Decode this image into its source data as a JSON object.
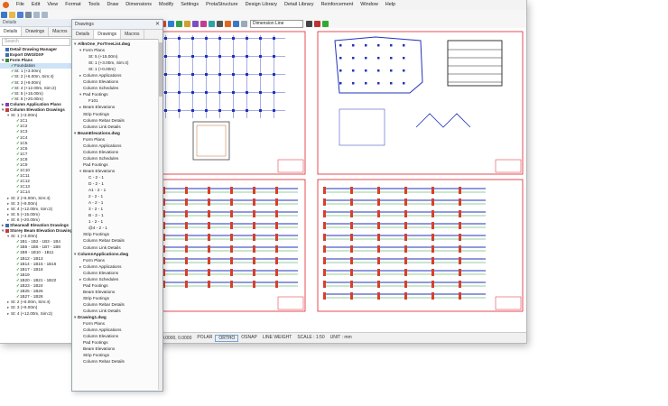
{
  "menu": [
    "File",
    "Edit",
    "View",
    "Format",
    "Tools",
    "Draw",
    "Dimensions",
    "Modify",
    "Settings",
    "ProtaStructure",
    "Design Library",
    "Detail Library",
    "Reinforcement",
    "Window",
    "Help"
  ],
  "toolbar": {
    "dimension_style": "Dimension Line"
  },
  "left_panel": {
    "title": "Details",
    "tabs": [
      "Details",
      "Drawings",
      "Macros"
    ],
    "search_placeholder": "Search",
    "tree": [
      {
        "label": "Detail Drawing Manager",
        "level": 0,
        "bold": true,
        "icon": "#3a6fb5"
      },
      {
        "label": "Export DWG/DXF",
        "level": 0,
        "bold": true,
        "icon": "#3a6fb5"
      },
      {
        "label": "Form Plans",
        "level": 0,
        "bold": true,
        "icon": "#3a8a3a",
        "tw": "▾"
      },
      {
        "label": "Foundation",
        "level": 1,
        "sel": true,
        "check": true
      },
      {
        "label": "St: 1 (+3.00m)",
        "level": 1,
        "check": true
      },
      {
        "label": "St: 2 (+6.00m, Sim:4)",
        "level": 1,
        "check": true
      },
      {
        "label": "St: 3 (+9.00m)",
        "level": 1,
        "check": true
      },
      {
        "label": "St: 4 (+12.00m, Sim:2)",
        "level": 1,
        "check": true
      },
      {
        "label": "St: 5 (+15.00m)",
        "level": 1,
        "check": true
      },
      {
        "label": "St: 6 (+20.00m)",
        "level": 1,
        "check": true
      },
      {
        "label": "Column Application Plans",
        "level": 0,
        "bold": true,
        "icon": "#8a3ab5",
        "tw": "▸"
      },
      {
        "label": "Column Elevation Drawings",
        "level": 0,
        "bold": true,
        "icon": "#c83a3a",
        "tw": "▾"
      },
      {
        "label": "St: 1 (+3.00m)",
        "level": 1,
        "tw": "▾"
      },
      {
        "label": "1C1",
        "level": 2,
        "check": true
      },
      {
        "label": "1C2",
        "level": 2,
        "check": true
      },
      {
        "label": "1C3",
        "level": 2,
        "check": true
      },
      {
        "label": "1C4",
        "level": 2,
        "check": true
      },
      {
        "label": "1C5",
        "level": 2,
        "check": true
      },
      {
        "label": "1C6",
        "level": 2,
        "check": true
      },
      {
        "label": "1C7",
        "level": 2,
        "check": true
      },
      {
        "label": "1C8",
        "level": 2,
        "check": true
      },
      {
        "label": "1C9",
        "level": 2,
        "check": true
      },
      {
        "label": "1C10",
        "level": 2,
        "check": true
      },
      {
        "label": "1C11",
        "level": 2,
        "check": true
      },
      {
        "label": "1C12",
        "level": 2,
        "check": true
      },
      {
        "label": "1C13",
        "level": 2,
        "check": true
      },
      {
        "label": "1C14",
        "level": 2,
        "check": true
      },
      {
        "label": "St: 2 (+6.00m, Sim:4)",
        "level": 1,
        "tw": "▸"
      },
      {
        "label": "St: 3 (+9.00m)",
        "level": 1,
        "tw": "▸"
      },
      {
        "label": "St: 4 (+12.00m, Sim:2)",
        "level": 1,
        "tw": "▸"
      },
      {
        "label": "St: 5 (+15.00m)",
        "level": 1,
        "tw": "▸"
      },
      {
        "label": "St: 6 (+20.00m)",
        "level": 1,
        "tw": "▸"
      },
      {
        "label": "Shearwall Elevation Drawings",
        "level": 0,
        "bold": true,
        "icon": "#3a6fb5",
        "tw": "▸"
      },
      {
        "label": "Storey Beam Elevation Drawings",
        "level": 0,
        "bold": true,
        "icon": "#c83a3a",
        "tw": "▾"
      },
      {
        "label": "St: 1 (+3.00m)",
        "level": 1,
        "tw": "▾"
      },
      {
        "label": "1B1 - 1B2 - 1B3 - 1B4",
        "level": 2,
        "check": true
      },
      {
        "label": "1B5 - 1B6 - 1B7 - 1B8",
        "level": 2,
        "check": true
      },
      {
        "label": "1B9 - 1B10 - 1B11",
        "level": 2,
        "check": true
      },
      {
        "label": "1B12 - 1B13",
        "level": 2,
        "check": true
      },
      {
        "label": "1B14 - 1B15 - 1B16",
        "level": 2,
        "check": true
      },
      {
        "label": "1B17 - 1B18",
        "level": 2,
        "check": true
      },
      {
        "label": "1B19",
        "level": 2,
        "check": true
      },
      {
        "label": "1B20 - 1B21 - 1B22",
        "level": 2,
        "check": true
      },
      {
        "label": "1B23 - 1B24",
        "level": 2,
        "check": true
      },
      {
        "label": "1B25 - 1B26",
        "level": 2,
        "check": true
      },
      {
        "label": "1B27 - 1B28",
        "level": 2,
        "check": true
      },
      {
        "label": "St: 2 (+6.00m, Sim:4)",
        "level": 1,
        "tw": "▸"
      },
      {
        "label": "St: 3 (+9.00m)",
        "level": 1,
        "tw": "▸"
      },
      {
        "label": "St: 4 (+12.00m, Sim:2)",
        "level": 1,
        "tw": "▸"
      }
    ]
  },
  "floating_panel": {
    "title": "Drawings",
    "close": "✕",
    "tabs": [
      "Details",
      "Drawings",
      "Macros"
    ],
    "tree": [
      {
        "label": "AllInOne_ForTreeList.dwg",
        "level": 0,
        "bold": true,
        "tw": "▾"
      },
      {
        "label": "Form Plans",
        "level": 1,
        "tw": "▾"
      },
      {
        "label": "St: 5 (+15.00m)",
        "level": 2
      },
      {
        "label": "St: 1 (+3.00m, Sim:4)",
        "level": 2
      },
      {
        "label": "St: 1 (+0.00m)",
        "level": 2
      },
      {
        "label": "Column Applications",
        "level": 1,
        "tw": "▸"
      },
      {
        "label": "Column Elevations",
        "level": 1
      },
      {
        "label": "Column Schedules",
        "level": 1
      },
      {
        "label": "Pad Footings",
        "level": 1,
        "tw": "▾"
      },
      {
        "label": "F101",
        "level": 2
      },
      {
        "label": "Beam Elevations",
        "level": 1,
        "tw": "▸"
      },
      {
        "label": "Strip Footings",
        "level": 1
      },
      {
        "label": "Column Rebar Details",
        "level": 1
      },
      {
        "label": "Column Link Details",
        "level": 1
      },
      {
        "label": "BeamElevations.dwg",
        "level": 0,
        "bold": true,
        "tw": "▾"
      },
      {
        "label": "Form Plans",
        "level": 1
      },
      {
        "label": "Column Applications",
        "level": 1
      },
      {
        "label": "Column Elevations",
        "level": 1
      },
      {
        "label": "Column Schedules",
        "level": 1
      },
      {
        "label": "Pad Footings",
        "level": 1
      },
      {
        "label": "Beam Elevations",
        "level": 1,
        "tw": "▾"
      },
      {
        "label": "C - 2 - 1",
        "level": 2
      },
      {
        "label": "D - 2 - 1",
        "level": 2
      },
      {
        "label": "A1 - 2 - 1",
        "level": 2
      },
      {
        "label": "2 - 2 - 1",
        "level": 2
      },
      {
        "label": "A - 2 - 1",
        "level": 2
      },
      {
        "label": "3 - 2 - 1",
        "level": 2
      },
      {
        "label": "B - 2 - 1",
        "level": 2
      },
      {
        "label": "1 - 2 - 1",
        "level": 2
      },
      {
        "label": "@4 - 2 - 1",
        "level": 2
      },
      {
        "label": "Strip Footings",
        "level": 1
      },
      {
        "label": "Column Rebar Details",
        "level": 1
      },
      {
        "label": "Column Link Details",
        "level": 1
      },
      {
        "label": "ColumnApplications.dwg",
        "level": 0,
        "bold": true,
        "tw": "▾"
      },
      {
        "label": "Form Plans",
        "level": 1
      },
      {
        "label": "Column Applications",
        "level": 1,
        "tw": "▸"
      },
      {
        "label": "Column Elevations",
        "level": 1
      },
      {
        "label": "Column Schedules",
        "level": 1,
        "tw": "▸"
      },
      {
        "label": "Pad Footings",
        "level": 1
      },
      {
        "label": "Beam Elevations",
        "level": 1
      },
      {
        "label": "Strip Footings",
        "level": 1
      },
      {
        "label": "Column Rebar Details",
        "level": 1
      },
      {
        "label": "Column Link Details",
        "level": 1
      },
      {
        "label": "Drawing1.dwg",
        "level": 0,
        "bold": true,
        "tw": "▾"
      },
      {
        "label": "Form Plans",
        "level": 1
      },
      {
        "label": "Column Applications",
        "level": 1
      },
      {
        "label": "Column Elevations",
        "level": 1
      },
      {
        "label": "Pad Footings",
        "level": 1
      },
      {
        "label": "Beam Elevations",
        "level": 1
      },
      {
        "label": "Strip Footings",
        "level": 1
      },
      {
        "label": "Column Rebar Details",
        "level": 1
      }
    ]
  },
  "statusbar": {
    "coords": "0.0000, 0.0000",
    "items": [
      "POLAR",
      "ORTHO",
      "OSNAP",
      "LINE WEIGHT",
      "SCALE : 1:50",
      "UNIT : mm"
    ],
    "active": "ORTHO"
  },
  "colors": {
    "drawing_border": "#e0202a",
    "drawing_blue": "#2233bb",
    "accent": "#e2661c"
  }
}
